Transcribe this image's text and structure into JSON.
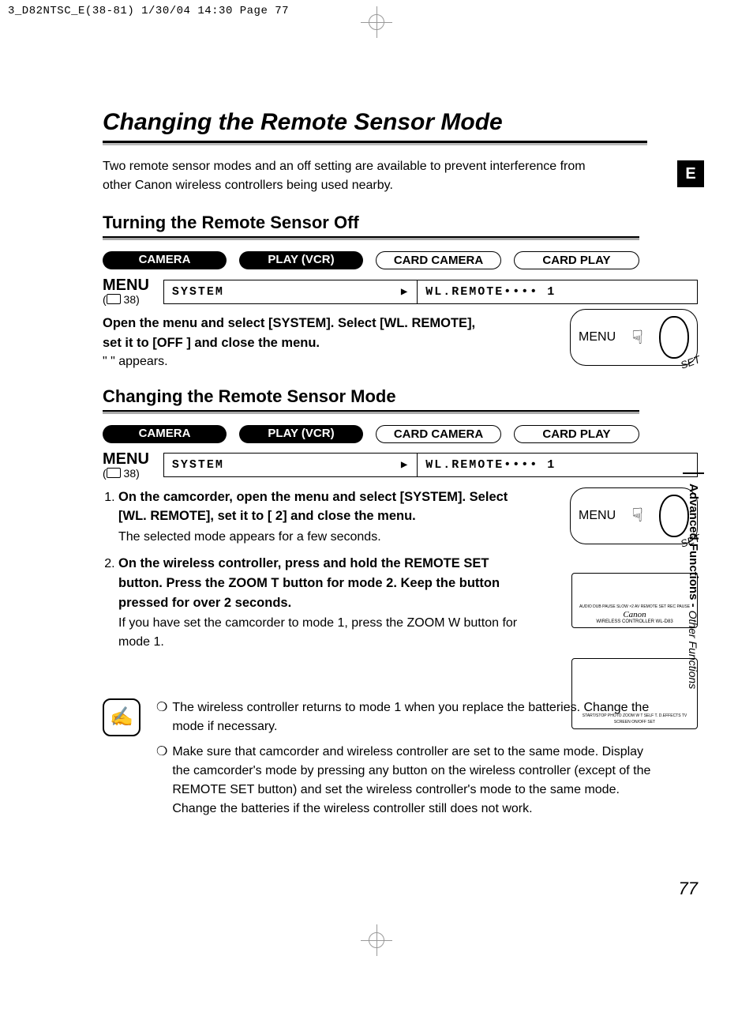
{
  "print_header": "3_D82NTSC_E(38-81)  1/30/04 14:30  Page 77",
  "lang_badge": "E",
  "page_title": "Changing the Remote Sensor Mode",
  "intro": "Two remote sensor modes and an off setting are available to prevent interference from other Canon wireless controllers being used nearby.",
  "section1_heading": "Turning the Remote Sensor Off",
  "section2_heading": "Changing the Remote Sensor Mode",
  "mode_pills": {
    "camera": "CAMERA",
    "play_vcr": "PLAY (VCR)",
    "card_camera": "CARD CAMERA",
    "card_play": "CARD PLAY"
  },
  "menu_label": "MENU",
  "menu_ref_prefix": "(",
  "menu_ref_page": " 38)",
  "menu_box_left": "SYSTEM",
  "menu_box_right_1": "WL.REMOTE•••• 1",
  "menu_box_right_2": "WL.REMOTE•••• 1",
  "section1_step": "Open the menu and select [SYSTEM]. Select [WL. REMOTE], set it to [OFF ] and close the menu.",
  "section1_note": "\" \" appears.",
  "illus_menu_label": "MENU",
  "illus_set_label": "SET",
  "steps2": {
    "s1b": "On the camcorder, open the menu and select [SYSTEM]. Select [WL. REMOTE], set it to [ 2] and close the menu.",
    "s1n": "The selected mode appears for a few seconds.",
    "s2b": "On the wireless controller, press and hold the REMOTE SET button. Press the ZOOM T button for mode 2. Keep the button pressed for over 2 seconds.",
    "s2n": "If you have set the camcorder to mode 1, press the ZOOM W button for mode 1."
  },
  "remote1": {
    "brand": "Canon",
    "model": "WIRELESS CONTROLLER WL-D83",
    "labels": "AUDIO DUB  PAUSE  SLOW  ×2  AV  REMOTE SET  REC PAUSE"
  },
  "remote2": {
    "labels": "START/STOP  PHOTO  ZOOM  W  T  SELF T.  D.EFFECTS  TV SCREEN  ON/OFF  SET"
  },
  "notes": {
    "n1": "The wireless controller returns to mode 1 when you replace the batteries. Change the mode if necessary.",
    "n2": "Make sure that camcorder and wireless controller are set to the same mode. Display the camcorder's mode by pressing any button on the wireless controller (except of the REMOTE SET button) and set the wireless controller's mode to the same mode. Change the batteries if the wireless controller still does not work."
  },
  "side_tab": {
    "l1": "Advanced Functions -",
    "l2": "Other Functions"
  },
  "page_number": "77",
  "bullet_char": "❍"
}
